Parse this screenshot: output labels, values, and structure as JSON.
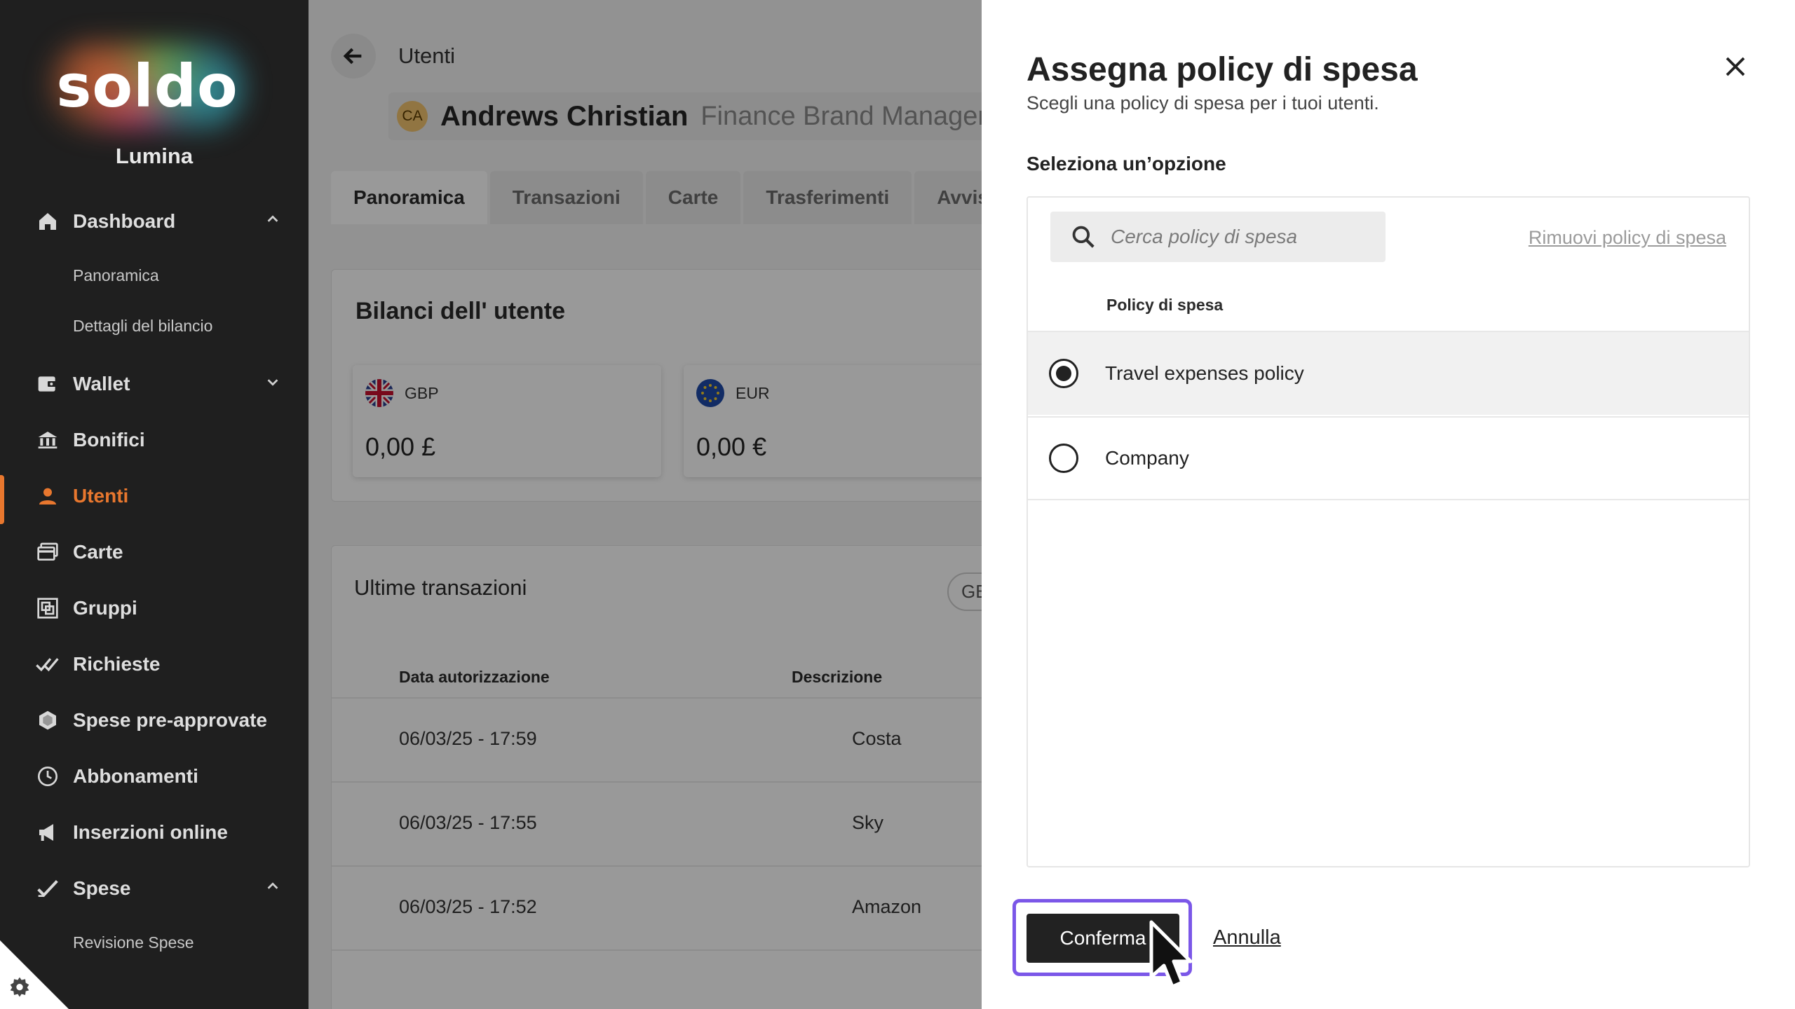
{
  "sidebar": {
    "logo_text": "soldo",
    "company": "Lumina",
    "items": [
      {
        "label": "Dashboard",
        "icon": "home-icon"
      },
      {
        "label": "Wallet",
        "icon": "wallet-icon"
      },
      {
        "label": "Bonifici",
        "icon": "bank-icon"
      },
      {
        "label": "Utenti",
        "icon": "user-icon"
      },
      {
        "label": "Carte",
        "icon": "cards-icon"
      },
      {
        "label": "Gruppi",
        "icon": "groups-icon"
      },
      {
        "label": "Richieste",
        "icon": "requests-icon"
      },
      {
        "label": "Spese pre-approvate",
        "icon": "hexagon-icon"
      },
      {
        "label": "Abbonamenti",
        "icon": "clock-icon"
      },
      {
        "label": "Inserzioni online",
        "icon": "megaphone-icon"
      },
      {
        "label": "Spese",
        "icon": "check-icon"
      }
    ],
    "dashboard_sub": [
      "Panoramica",
      "Dettagli del bilancio"
    ],
    "spese_sub": [
      "Revisione Spese"
    ],
    "active_color": "#e8772e"
  },
  "main": {
    "breadcrumb": "Utenti",
    "user": {
      "initials": "CA",
      "name": "Andrews Christian",
      "role": "Finance Brand Manager"
    },
    "tabs": [
      "Panoramica",
      "Transazioni",
      "Carte",
      "Trasferimenti",
      "Avvisi"
    ],
    "balances_title": "Bilanci dell' utente",
    "balances": [
      {
        "currency": "GBP",
        "amount": "0,00 £"
      },
      {
        "currency": "EUR",
        "amount": "0,00 €"
      }
    ],
    "transactions_title": "Ultime transazioni",
    "currency_filter": "GBP",
    "columns": [
      "Data autorizzazione",
      "Descrizione"
    ],
    "rows": [
      {
        "date": "06/03/25 - 17:59",
        "desc": "Costa"
      },
      {
        "date": "06/03/25 - 17:55",
        "desc": "Sky"
      },
      {
        "date": "06/03/25 - 17:52",
        "desc": "Amazon"
      }
    ]
  },
  "drawer": {
    "title": "Assegna policy di spesa",
    "subtitle": "Scegli una policy di spesa per i tuoi utenti.",
    "section_label": "Seleziona un’opzione",
    "search_placeholder": "Cerca policy di spesa",
    "remove_link": "Rimuovi policy di spesa",
    "column_header": "Policy di spesa",
    "options": [
      {
        "label": "Travel expenses policy",
        "selected": true
      },
      {
        "label": "Company",
        "selected": false
      }
    ],
    "confirm_label": "Conferma",
    "cancel_label": "Annulla",
    "focus_ring_color": "#7b57e8"
  }
}
